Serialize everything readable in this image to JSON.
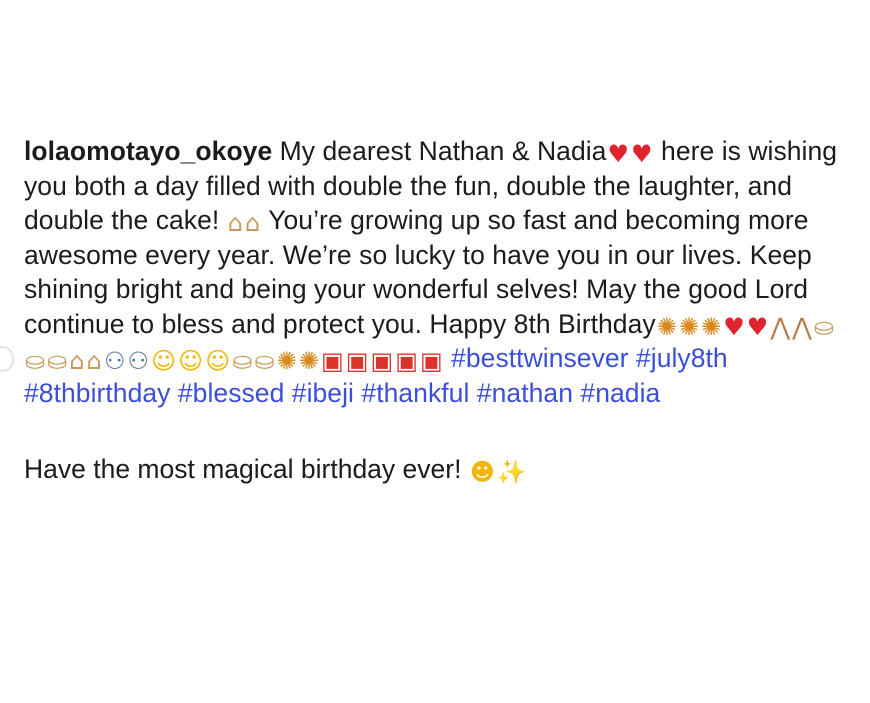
{
  "post": {
    "username": "lolaomotayo_okoye",
    "text_1": " My dearest Nathan & Nadia",
    "text_2": " here is wishing you both a day filled with double the fun, double the laughter, and double the cake! ",
    "text_3": " You’re growing up so fast and becoming more awesome every year. We’re so lucky to have you in our lives. Keep shining bright and being your wonderful selves! May the good Lord continue to bless and protect you. Happy 8th Birthday",
    "hashtags": [
      "#besttwinsever",
      "#july8th",
      "#8thbirthday",
      "#blessed",
      "#ibeji",
      "#thankful",
      "#nathan",
      "#nadia"
    ],
    "followup_text": "Have the most magical birthday ever! "
  },
  "icons": {
    "heart": "red-heart-icon",
    "cupcake": "cupcake-icon",
    "party_popper": "party-popper-icon",
    "gift": "gift-icon",
    "pray": "folded-hands-icon",
    "birthday_cake": "birthday-cake-icon",
    "people": "two-people-icon",
    "heart_eyes": "heart-eyes-icon",
    "confetti_ball": "confetti-ball-icon",
    "partying_face": "partying-face-icon",
    "sparkles": "sparkles-icon"
  },
  "colors": {
    "text": "#1c1c1c",
    "hashtag": "#3b4fd9",
    "background": "#ffffff"
  }
}
